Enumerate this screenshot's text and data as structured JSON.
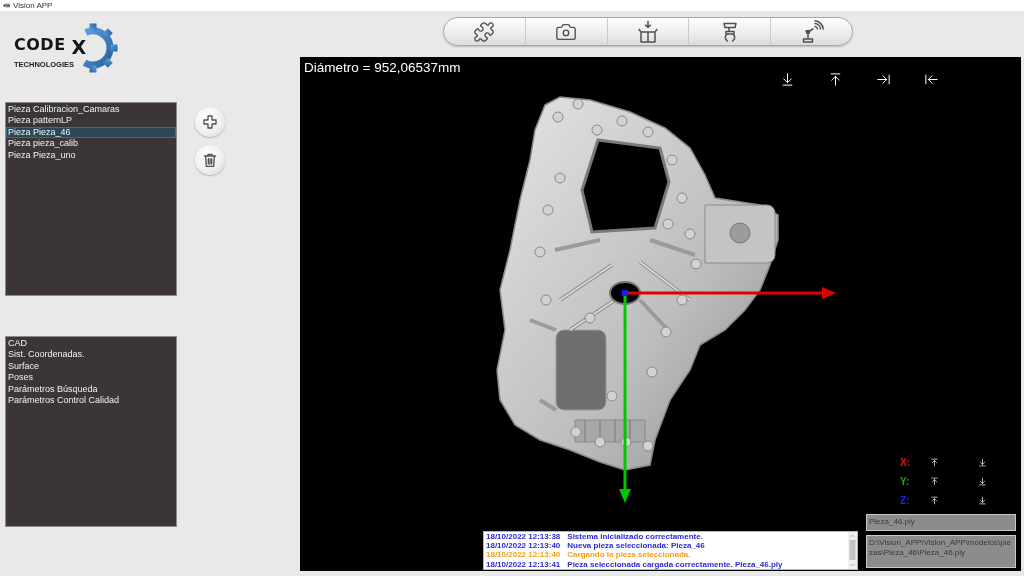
{
  "window": {
    "title": "Vision APP"
  },
  "logo": {
    "wordmark": "CODE",
    "mark": "X",
    "tagline": "TECHNOLOGIES"
  },
  "parts_list": {
    "items": [
      {
        "label": "Pieza Calibracion_Camaras",
        "selected": false
      },
      {
        "label": "Pieza patternLP",
        "selected": false
      },
      {
        "label": "Pieza Pieza_46",
        "selected": true
      },
      {
        "label": "Pieza pieza_calib",
        "selected": false
      },
      {
        "label": "Pieza Pieza_uno",
        "selected": false
      }
    ]
  },
  "sections_list": {
    "items": [
      {
        "label": "CAD",
        "selected": false
      },
      {
        "label": "Sist. Coordenadas.",
        "selected": false
      },
      {
        "label": "Surface",
        "selected": false
      },
      {
        "label": "Poses",
        "selected": false
      },
      {
        "label": "Parámetros Búsqueda",
        "selected": false
      },
      {
        "label": "Parámetros Control Calidad",
        "selected": false
      }
    ]
  },
  "viewer": {
    "measurement": "Diámetro = 952,06537mm",
    "axes": [
      {
        "label": "X:",
        "color": "#e01010"
      },
      {
        "label": "Y:",
        "color": "#10b010"
      },
      {
        "label": "Z:",
        "color": "#2020f0"
      }
    ],
    "file_name": "Pieza_46.ply",
    "file_path": "D:\\Vision_APP\\Vision_APP\\modelos\\piezas\\Pieza_46\\Pieza_46.ply"
  },
  "log": [
    {
      "time": "18/10/2022 12:13:38",
      "message": "Sistema inicializado correctamente.",
      "color": "#2a2ad8"
    },
    {
      "time": "18/10/2022 12:13:40",
      "message": "Nueva pieza seleccionada: Pieza_46",
      "color": "#2a2ad8"
    },
    {
      "time": "18/10/2022 12:13:40",
      "message": "Cargando la pieza seleccionada.",
      "color": "#f0a020"
    },
    {
      "time": "18/10/2022 12:13:41",
      "message": "Pieza seleccionada cargada correctamente. Pieza_46.ply",
      "color": "#2a2ad8"
    }
  ]
}
